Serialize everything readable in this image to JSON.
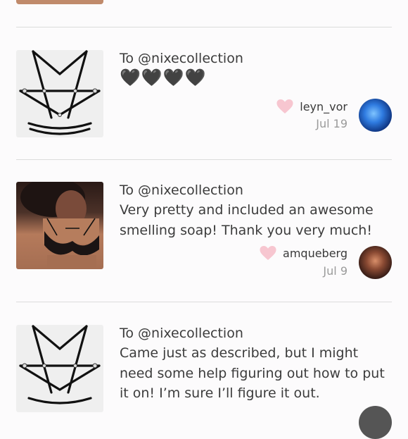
{
  "reviews": [
    {
      "to": "To @nixecollection",
      "message": "🖤🖤🖤🖤",
      "username": "leyn_vor",
      "date": "Jul 19",
      "thumb_icon": "harness-product-image",
      "avatar_color": "#2f7be0"
    },
    {
      "to": "To @nixecollection",
      "message": "Very pretty and included an awesome smelling soap! Thank you very much!",
      "username": "amqueberg",
      "date": "Jul 9",
      "thumb_icon": "bra-product-image",
      "avatar_color": "#8a4a33"
    },
    {
      "to": "To @nixecollection",
      "message": "Came just as described, but I might need some help figuring out how to put it on! I’m sure I’ll figure it out.",
      "thumb_icon": "harness-product-image"
    }
  ],
  "colors": {
    "heart": "#f7c6d0",
    "divider": "#dcdcdc",
    "background": "#fcfbfc"
  }
}
